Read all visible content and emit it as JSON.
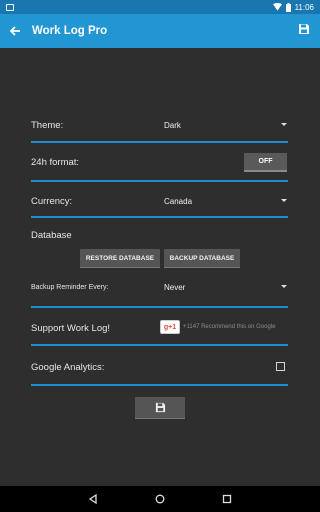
{
  "status_bar": {
    "time": "11:06"
  },
  "app_bar": {
    "title": "Work Log Pro",
    "back_icon": "arrow-left-icon",
    "save_icon": "floppy-disk-icon"
  },
  "settings": {
    "theme": {
      "label": "Theme:",
      "value": "Dark"
    },
    "format24h": {
      "label": "24h format:",
      "value": "OFF"
    },
    "currency": {
      "label": "Currency:",
      "value": "Canada"
    },
    "database": {
      "label": "Database",
      "restore_label": "RESTORE DATABASE",
      "backup_label": "BACKUP DATABASE"
    },
    "backup_reminder": {
      "label": "Backup Reminder Every:",
      "value": "Never"
    },
    "support": {
      "label": "Support Work Log!",
      "gplus_badge": "g+1",
      "gplus_text": "+1147 Recommend this on Google"
    },
    "analytics": {
      "label": "Google Analytics:",
      "checked": false
    },
    "save_icon": "floppy-disk-icon"
  },
  "colors": {
    "app_bar": "#2196d3",
    "status_bar": "#1976b0",
    "accent_line": "#1d8ed0",
    "background": "#2e2e2e"
  }
}
